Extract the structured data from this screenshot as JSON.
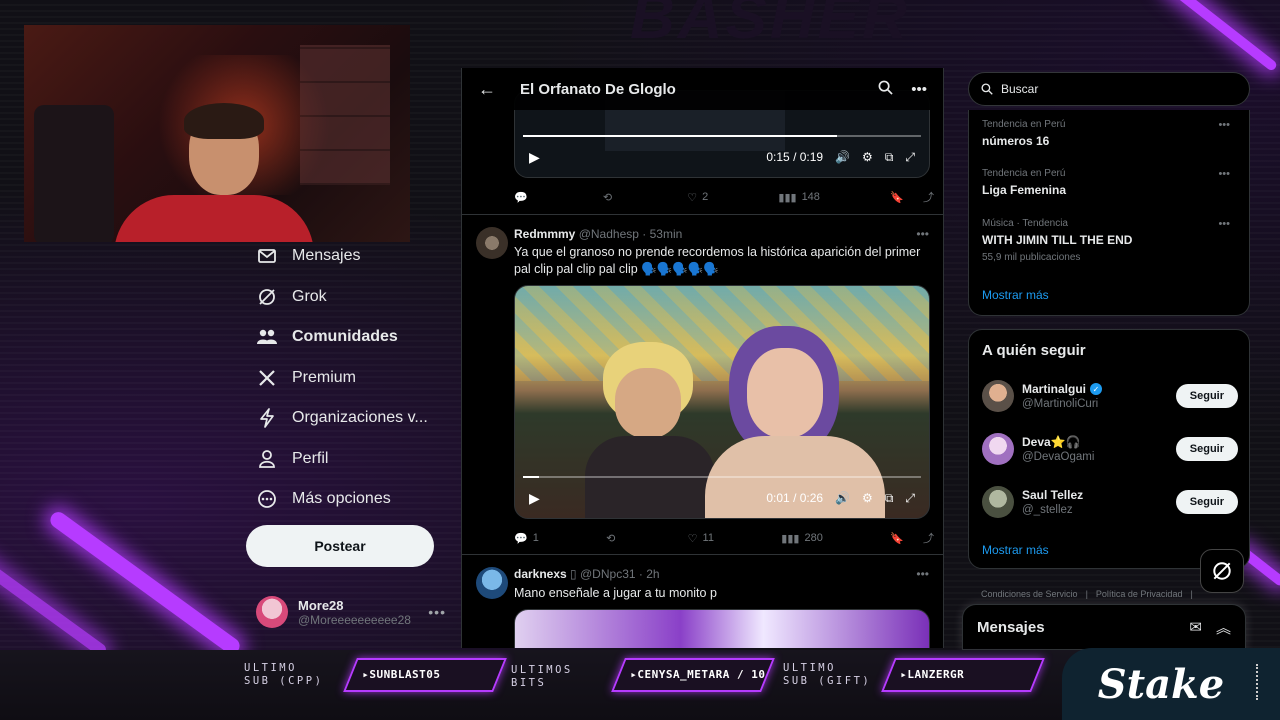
{
  "page": {
    "title": "El Orfanato De Gloglo"
  },
  "nav": {
    "items": [
      {
        "label": "Mensajes",
        "icon": "mail-icon",
        "bold": false
      },
      {
        "label": "Grok",
        "icon": "grok-icon",
        "bold": false
      },
      {
        "label": "Comunidades",
        "icon": "communities-icon",
        "bold": true
      },
      {
        "label": "Premium",
        "icon": "x-logo-icon",
        "bold": false
      },
      {
        "label": "Organizaciones v...",
        "icon": "lightning-icon",
        "bold": false
      },
      {
        "label": "Perfil",
        "icon": "person-icon",
        "bold": false
      },
      {
        "label": "Más opciones",
        "icon": "more-circle-icon",
        "bold": false
      }
    ],
    "post_label": "Postear",
    "account": {
      "name": "More28",
      "handle": "@Moreeeeeeeeee28"
    }
  },
  "feed": {
    "video1": {
      "time": "0:15 / 0:19",
      "progress": 0.79
    },
    "tweet0_actions": {
      "replies": "",
      "reposts": "",
      "likes": "2",
      "views": "148"
    },
    "tweet1": {
      "name": "Redmmmy",
      "handle": "@Nadhesp",
      "time": "· 53min",
      "text": "Ya que el granoso no prende recordemos la histórica aparición del primer pal clip pal clip pal clip 🗣️🗣️🗣️🗣️🗣️",
      "video_time": "0:01 / 0:26",
      "progress": 0.04,
      "replies": "1",
      "reposts": "",
      "likes": "11",
      "views": "280"
    },
    "tweet2": {
      "name": "darknexs",
      "handle": "@DNpc31",
      "time": "· 2h",
      "text": "Mano enseñale a jugar a tu monito p"
    }
  },
  "sidebar": {
    "search_placeholder": "Buscar",
    "trends": [
      {
        "meta": "Tendencia en Perú",
        "name": "números 16",
        "count": ""
      },
      {
        "meta": "Tendencia en Perú",
        "name": "Liga Femenina",
        "count": ""
      },
      {
        "meta": "Música · Tendencia",
        "name": "WITH JIMIN TILL THE END",
        "count": "55,9 mil publicaciones"
      }
    ],
    "show_more": "Mostrar más",
    "who_to_follow_title": "A quién seguir",
    "follow": [
      {
        "name": "Martinalgui",
        "handle": "@MartinoliCuri",
        "verified": true,
        "button": "Seguir"
      },
      {
        "name": "Deva⭐🎧",
        "handle": "@DevaOgami",
        "verified": false,
        "button": "Seguir"
      },
      {
        "name": "Saul Tellez",
        "handle": "@_stellez",
        "verified": false,
        "button": "Seguir"
      }
    ],
    "show_more2": "Mostrar más",
    "footer": [
      "Condiciones de Servicio",
      "|",
      "Política de Privacidad",
      "|"
    ],
    "messages_title": "Mensajes"
  },
  "overlay": {
    "last_sub_label": [
      "ULTIMO",
      "SUB (CPP)"
    ],
    "last_sub_value": "SUNBLAST05",
    "last_bits_label": [
      "ULTIMOS",
      "BITS"
    ],
    "last_bits_value": "CENYSA_METARA / 10",
    "last_gift_label": [
      "ULTIMO",
      "SUB (GIFT)"
    ],
    "last_gift_value": "LANZERGR",
    "sponsor": "Stake",
    "bg_brand": "BASHER"
  },
  "colors": {
    "accent": "#1d9bf0",
    "neon": "#b63bff",
    "bg": "#000000"
  }
}
